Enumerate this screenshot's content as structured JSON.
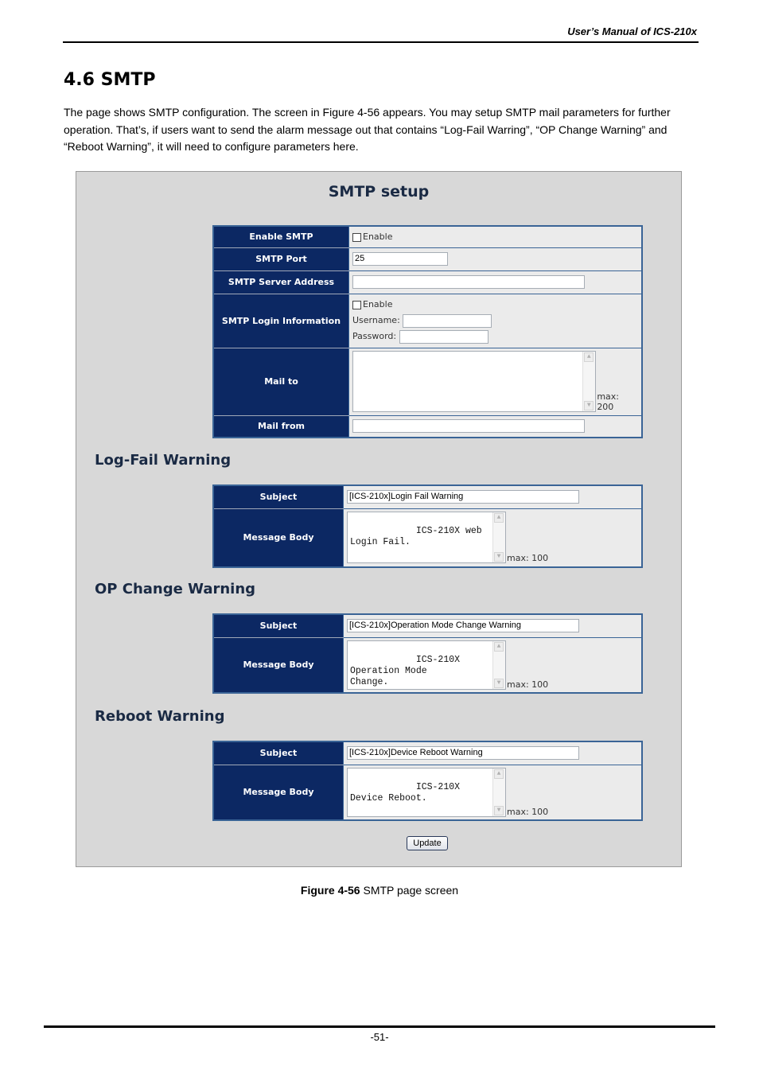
{
  "header": {
    "manual_title": "User’s Manual of ICS-210x"
  },
  "section": {
    "title": "4.6 SMTP",
    "intro": "The page shows SMTP configuration. The screen in Figure 4-56 appears. You may setup SMTP mail parameters for further operation. That’s, if users want to send the alarm message out that contains “Log-Fail Warring”, “OP Change Warning” and “Reboot Warning”, it will need to configure parameters here."
  },
  "figure": {
    "title": "SMTP setup",
    "smtp": {
      "enable_smtp": {
        "label": "Enable SMTP",
        "checkbox_label": "Enable",
        "checked": false
      },
      "port": {
        "label": "SMTP Port",
        "value": "25"
      },
      "server": {
        "label": "SMTP Server Address",
        "value": ""
      },
      "login": {
        "label": "SMTP Login Information",
        "checkbox_label": "Enable",
        "checked": false,
        "username_label": "Username:",
        "username_value": "",
        "password_label": "Password:",
        "password_value": ""
      },
      "mail_to": {
        "label": "Mail to",
        "value": "",
        "max": "max: 200"
      },
      "mail_from": {
        "label": "Mail from",
        "value": ""
      }
    },
    "log_fail": {
      "heading": "Log-Fail Warning",
      "subject_label": "Subject",
      "subject_value": "[ICS-210x]Login Fail Warning",
      "body_label": "Message Body",
      "body_value": "ICS-210X web Login Fail.",
      "max": "max: 100"
    },
    "op_change": {
      "heading": "OP Change Warning",
      "subject_label": "Subject",
      "subject_value": "[ICS-210x]Operation Mode Change Warning",
      "body_label": "Message Body",
      "body_value": "ICS-210X Operation Mode\nChange.",
      "max": "max: 100"
    },
    "reboot": {
      "heading": "Reboot Warning",
      "subject_label": "Subject",
      "subject_value": "[ICS-210x]Device Reboot Warning",
      "body_label": "Message Body",
      "body_value": "ICS-210X Device Reboot.",
      "max": "max: 100"
    },
    "update_label": "Update"
  },
  "caption": {
    "bold": "Figure 4-56",
    "text": " SMTP page screen"
  },
  "footer": {
    "page_number": "-51-"
  }
}
